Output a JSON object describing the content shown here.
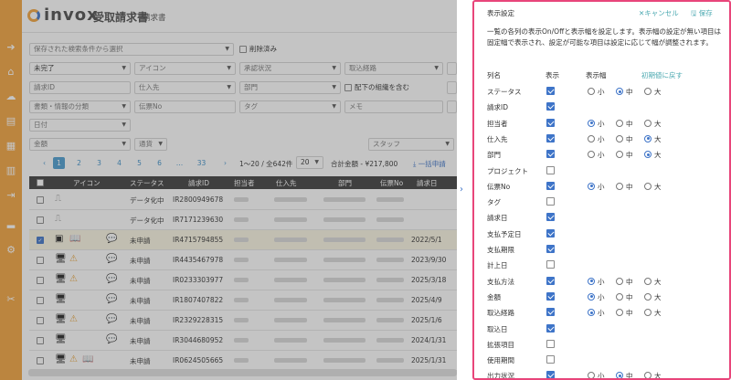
{
  "header": {
    "logo": "invox",
    "logo_sub": "受取請求書",
    "page_title": "請求書"
  },
  "nav_icons": [
    "arrow-right-circle-icon",
    "home-icon",
    "cloud-upload-icon",
    "document-icon",
    "document-alt-icon",
    "building-icon",
    "export-icon",
    "chart-icon",
    "gear-icon",
    "tools-icon"
  ],
  "filters": {
    "saved_search_placeholder": "保存された検索条件から選択",
    "include_deleted": "削除済み",
    "status": "未完了",
    "icon": "アイコン",
    "approval": "承認状況",
    "capture_route": "取込経路",
    "request_id": "請求ID",
    "supplier": "仕入先",
    "department": "部門",
    "include_sub_org": "配下の組織を含む",
    "doc_category": "書類・情報の分類",
    "slip_no": "伝票No",
    "tag": "タグ",
    "memo": "メモ",
    "date": "日付",
    "amount": "金額",
    "currency": "通貨",
    "staff": "スタッフ"
  },
  "pagination": {
    "pages": [
      "1",
      "2",
      "3",
      "4",
      "5",
      "6",
      "…",
      "33"
    ],
    "range": "1〜20 / 全642件",
    "per_page": "20",
    "total_label": "合計金額 - ¥217,800",
    "bulk_apply": "一括申請"
  },
  "table": {
    "headers": [
      "アイコン",
      "ステータス",
      "請求ID",
      "担当者",
      "仕入先",
      "部門",
      "伝票No",
      "請求日"
    ],
    "rows": [
      {
        "icons": [
          "stamp-icon"
        ],
        "status": "データ化中",
        "id": "IR2800949678",
        "date": ""
      },
      {
        "icons": [
          "stamp-icon"
        ],
        "status": "データ化中",
        "id": "IR7171239630",
        "date": ""
      },
      {
        "icons": [
          "chip-icon",
          "book-icon",
          "comment-icon"
        ],
        "status": "未申請",
        "id": "IR4715794855",
        "date": "2022/5/1",
        "checked": true
      },
      {
        "icons": [
          "monitor-icon",
          "warning-icon",
          "comment-icon"
        ],
        "status": "未申請",
        "id": "IR4435467978",
        "date": "2023/9/30"
      },
      {
        "icons": [
          "monitor-icon",
          "warning-icon",
          "comment-icon"
        ],
        "status": "未申請",
        "id": "IR0233303977",
        "date": "2025/3/18"
      },
      {
        "icons": [
          "monitor-icon",
          "comment-icon"
        ],
        "status": "未申請",
        "id": "IR1807407822",
        "date": "2025/4/9"
      },
      {
        "icons": [
          "monitor-icon",
          "warning-icon",
          "comment-icon"
        ],
        "status": "未申請",
        "id": "IR2329228315",
        "date": "2025/1/6"
      },
      {
        "icons": [
          "monitor-icon",
          "comment-icon"
        ],
        "status": "未申請",
        "id": "IR3044680952",
        "date": "2024/1/31"
      },
      {
        "icons": [
          "monitor-icon",
          "warning-icon",
          "book-icon"
        ],
        "status": "未申請",
        "id": "IR0624505665",
        "date": "2025/1/31"
      }
    ]
  },
  "panel": {
    "title": "表示設定",
    "cancel": "✕キャンセル",
    "save": "保存",
    "description": "一覧の各列の表示On/Offと表示幅を設定します。表示幅の設定が無い項目は固定幅で表示され、設定が可能な項目は設定に応じて幅が調整されます。",
    "col_name": "列名",
    "col_show": "表示",
    "col_width": "表示幅",
    "reset": "初期値に戻す",
    "width_labels": [
      "小",
      "中",
      "大"
    ],
    "items": [
      {
        "name": "ステータス",
        "show": true,
        "width": "中"
      },
      {
        "name": "請求ID",
        "show": true,
        "width": ""
      },
      {
        "name": "担当者",
        "show": true,
        "width": "小"
      },
      {
        "name": "仕入先",
        "show": true,
        "width": "大"
      },
      {
        "name": "部門",
        "show": true,
        "width": "大"
      },
      {
        "name": "プロジェクト",
        "show": false,
        "width": ""
      },
      {
        "name": "伝票No",
        "show": true,
        "width": "小"
      },
      {
        "name": "タグ",
        "show": false,
        "width": ""
      },
      {
        "name": "請求日",
        "show": true,
        "width": ""
      },
      {
        "name": "支払予定日",
        "show": true,
        "width": ""
      },
      {
        "name": "支払期限",
        "show": true,
        "width": ""
      },
      {
        "name": "計上日",
        "show": false,
        "width": ""
      },
      {
        "name": "支払方法",
        "show": true,
        "width": "小"
      },
      {
        "name": "金額",
        "show": true,
        "width": "小"
      },
      {
        "name": "取込経路",
        "show": true,
        "width": "小"
      },
      {
        "name": "取込日",
        "show": true,
        "width": ""
      },
      {
        "name": "拡張項目",
        "show": false,
        "width": ""
      },
      {
        "name": "使用期間",
        "show": false,
        "width": ""
      },
      {
        "name": "出力状況",
        "show": true,
        "width": "中"
      }
    ]
  },
  "colors": {
    "accent": "#f2a23c",
    "link": "#4aa8b0",
    "highlight_border": "#e8457a",
    "primary": "#3e74c8"
  }
}
